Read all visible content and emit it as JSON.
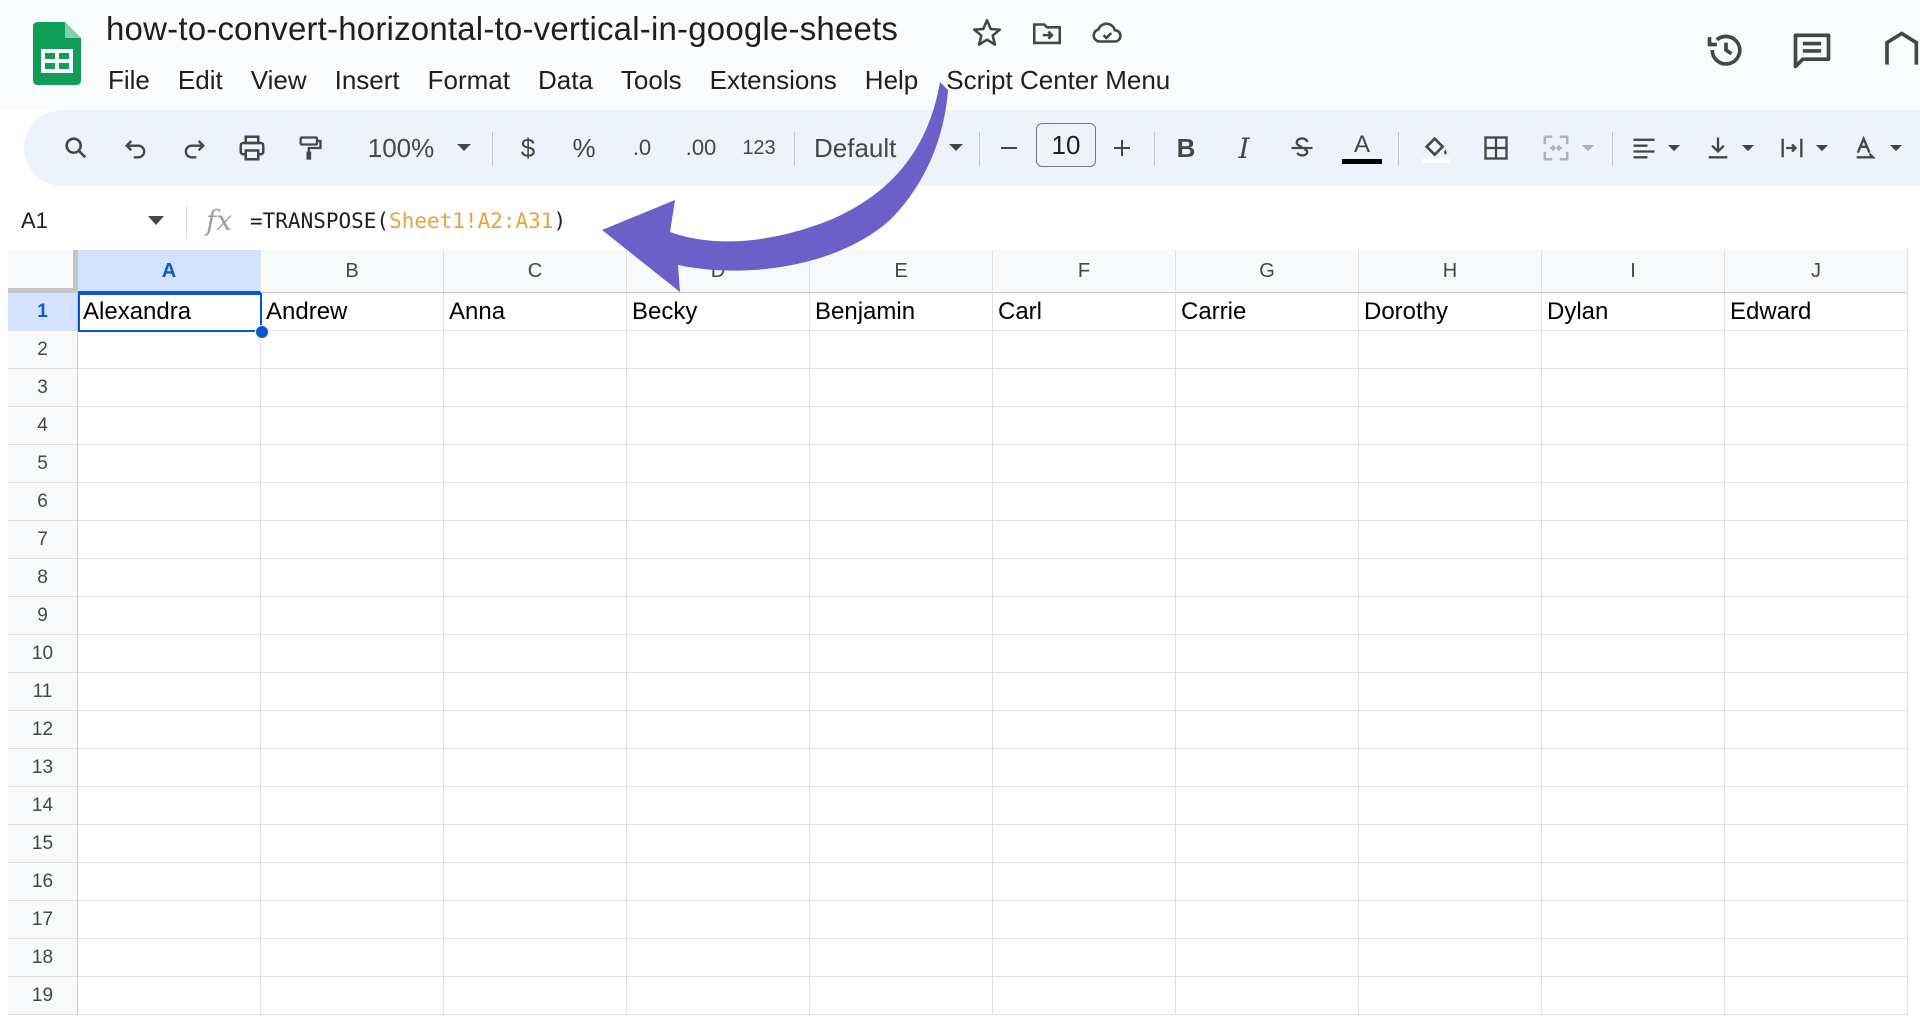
{
  "app": {
    "title": "how-to-convert-horizontal-to-vertical-in-google-sheets"
  },
  "menu": [
    "File",
    "Edit",
    "View",
    "Insert",
    "Format",
    "Data",
    "Tools",
    "Extensions",
    "Help",
    "Script Center Menu"
  ],
  "toolbar": {
    "zoom": "100%",
    "currency": "$",
    "percent": "%",
    "decrease_decimal": ".0",
    "increase_decimal": ".00",
    "more_formats": "123",
    "font": "Default",
    "font_size": "10",
    "bold": "B",
    "italic": "I",
    "text_color_letter": "A"
  },
  "formula_bar": {
    "namebox": "A1",
    "fx": "fx",
    "formula_prefix": "=TRANSPOSE(",
    "formula_ref": "Sheet1!A2:A31",
    "formula_suffix": ")"
  },
  "grid": {
    "columns": [
      "A",
      "B",
      "C",
      "D",
      "E",
      "F",
      "G",
      "H",
      "I",
      "J"
    ],
    "rows": [
      "1",
      "2",
      "3",
      "4",
      "5",
      "6",
      "7",
      "8",
      "9",
      "10",
      "11",
      "12",
      "13",
      "14",
      "15",
      "16",
      "17",
      "18",
      "19"
    ],
    "row1": [
      "Alexandra",
      "Andrew",
      "Anna",
      "Becky",
      "Benjamin",
      "Carl",
      "Carrie",
      "Dorothy",
      "Dylan",
      "Edward"
    ],
    "active_cell": "A1"
  },
  "colors": {
    "accent": "#0b57d0",
    "arrow": "#6c5fc7",
    "sheets_green": "#0f9d58",
    "reference": "#e8a33d"
  },
  "icons": [
    "sheets-logo-icon",
    "star-icon",
    "move-to-folder-icon",
    "cloud-saved-icon",
    "version-history-icon",
    "comments-icon",
    "search-icon",
    "undo-icon",
    "redo-icon",
    "print-icon",
    "paint-format-icon",
    "borders-icon",
    "merge-cells-icon",
    "align-left-icon",
    "vertical-align-icon",
    "text-wrap-icon",
    "text-rotation-icon"
  ]
}
